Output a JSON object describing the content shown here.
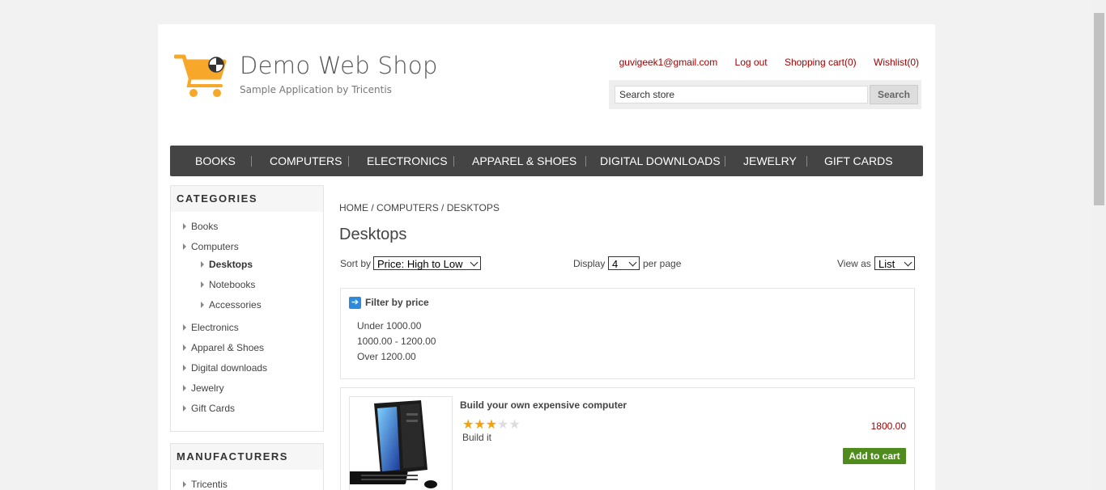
{
  "header": {
    "title": "Demo Web Shop",
    "subtitle": "Sample Application by Tricentis",
    "links": {
      "account": "guvigeek1@gmail.com",
      "logout": "Log out",
      "cart": "Shopping cart(0)",
      "wishlist": "Wishlist(0)"
    },
    "search": {
      "value": "Search store",
      "button": "Search"
    }
  },
  "topmenu": [
    "BOOKS",
    "COMPUTERS",
    "ELECTRONICS",
    "APPAREL & SHOES",
    "DIGITAL DOWNLOADS",
    "JEWELRY",
    "GIFT CARDS"
  ],
  "sidebar": {
    "categories_title": "CATEGORIES",
    "categories": [
      "Books",
      "Computers",
      "Electronics",
      "Apparel & Shoes",
      "Digital downloads",
      "Jewelry",
      "Gift Cards"
    ],
    "subcategories": [
      "Desktops",
      "Notebooks",
      "Accessories"
    ],
    "active_subcategory": "Desktops",
    "manufacturers_title": "MANUFACTURERS",
    "manufacturers": [
      "Tricentis"
    ]
  },
  "breadcrumb": {
    "home": "HOME",
    "sep": "/",
    "parent": "COMPUTERS",
    "current": "DESKTOPS"
  },
  "main": {
    "title": "Desktops",
    "sort_label": "Sort by",
    "sort_value": "Price: High to Low",
    "display_label": "Display",
    "display_value": "4",
    "per_page_label": "per page",
    "view_label": "View as",
    "view_value": "List"
  },
  "filter": {
    "title": "Filter by price",
    "options": [
      "Under 1000.00",
      "1000.00 - 1200.00",
      "Over 1200.00"
    ]
  },
  "products": [
    {
      "title": "Build your own expensive computer",
      "rating": 3,
      "rating_max": 5,
      "description": "Build it",
      "price": "1800.00",
      "button": "Add to cart"
    }
  ],
  "colors": {
    "accent": "#a40000",
    "menu_bg": "#444444",
    "cart_button": "#4f8c1d",
    "logo": "#f7a82b"
  }
}
